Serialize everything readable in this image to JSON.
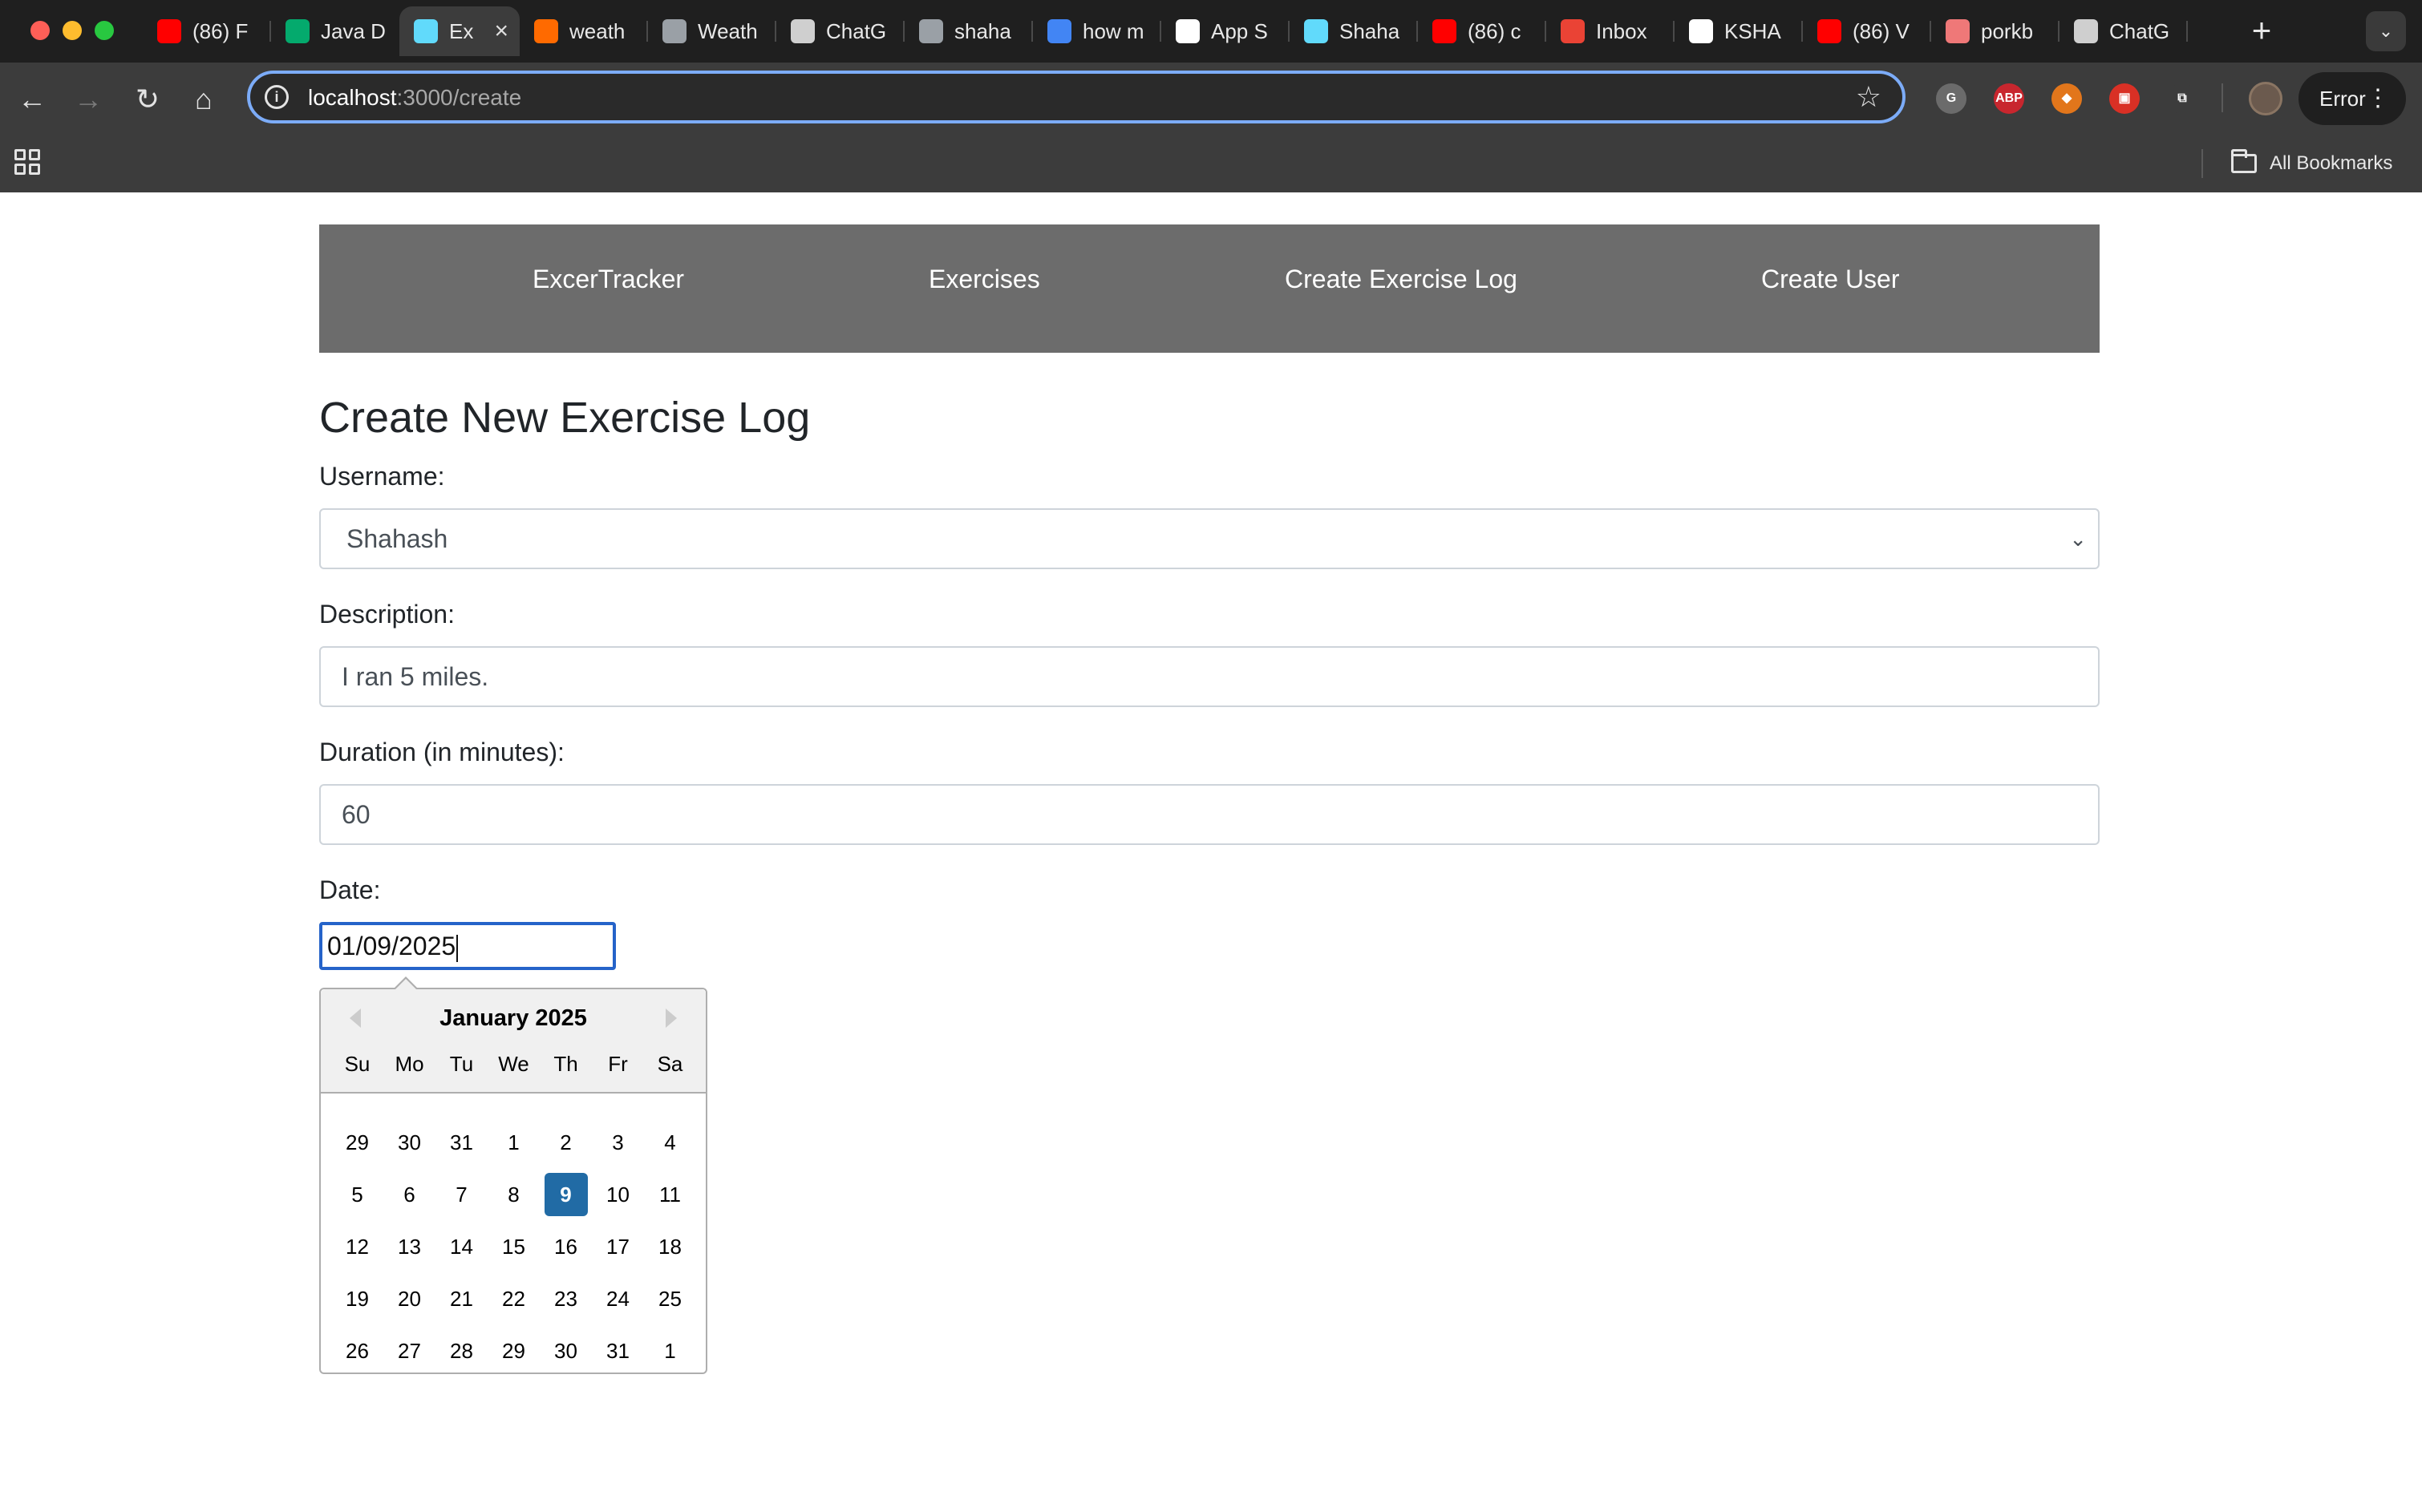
{
  "browser": {
    "tabs": [
      {
        "title": "(86) F",
        "icon": "youtube-icon",
        "color": "#ff0000"
      },
      {
        "title": "Java D",
        "icon": "w3schools-icon",
        "color": "#04aa6d"
      },
      {
        "title": "Ex",
        "icon": "react-icon",
        "color": "#61dafb",
        "active": true
      },
      {
        "title": "weath",
        "icon": "flame-icon",
        "color": "#ff6a00"
      },
      {
        "title": "Weath",
        "icon": "globe-icon",
        "color": "#9aa0a6"
      },
      {
        "title": "ChatG",
        "icon": "chatgpt-icon",
        "color": "#cfcfcf"
      },
      {
        "title": "shaha",
        "icon": "globe-icon",
        "color": "#9aa0a6"
      },
      {
        "title": "how m",
        "icon": "google-icon",
        "color": "#4285f4"
      },
      {
        "title": "App S",
        "icon": "github-icon",
        "color": "#ffffff"
      },
      {
        "title": "Shaha",
        "icon": "react-icon",
        "color": "#61dafb"
      },
      {
        "title": "(86) c",
        "icon": "youtube-icon",
        "color": "#ff0000"
      },
      {
        "title": "Inbox",
        "icon": "gmail-icon",
        "color": "#ea4335"
      },
      {
        "title": "KSHA",
        "icon": "github-icon",
        "color": "#ffffff"
      },
      {
        "title": "(86) V",
        "icon": "youtube-icon",
        "color": "#ff0000"
      },
      {
        "title": "porkb",
        "icon": "porkbun-icon",
        "color": "#ef7878"
      },
      {
        "title": "ChatG",
        "icon": "chatgpt-icon",
        "color": "#cfcfcf"
      }
    ],
    "url_host": "localhost",
    "url_path": ":3000/create",
    "error_label": "Error",
    "all_bookmarks_label": "All Bookmarks",
    "extensions": [
      {
        "name": "grammarly-icon",
        "label": "G",
        "color": "#6b6b6b"
      },
      {
        "name": "adblock-plus-icon",
        "label": "ABP",
        "color": "#c8262e"
      },
      {
        "name": "metamask-icon",
        "label": "◆",
        "color": "#e2761b"
      },
      {
        "name": "extension-red-icon",
        "label": "▣",
        "color": "#d93025"
      },
      {
        "name": "puzzle-icon",
        "label": "⧉",
        "color": "#3c3c3c"
      }
    ]
  },
  "nav": {
    "brand": "ExcerTracker",
    "links": [
      "Exercises",
      "Create Exercise Log",
      "Create User"
    ]
  },
  "form": {
    "title": "Create New Exercise Log",
    "username_label": "Username:",
    "username_value": "Shahash",
    "description_label": "Description:",
    "description_value": "I ran 5 miles.",
    "duration_label": "Duration (in minutes):",
    "duration_value": "60",
    "date_label": "Date:",
    "date_value": "01/09/2025"
  },
  "datepicker": {
    "month_label": "January 2025",
    "weekdays": [
      "Su",
      "Mo",
      "Tu",
      "We",
      "Th",
      "Fr",
      "Sa"
    ],
    "days": [
      "29",
      "30",
      "31",
      "1",
      "2",
      "3",
      "4",
      "5",
      "6",
      "7",
      "8",
      "9",
      "10",
      "11",
      "12",
      "13",
      "14",
      "15",
      "16",
      "17",
      "18",
      "19",
      "20",
      "21",
      "22",
      "23",
      "24",
      "25",
      "26",
      "27",
      "28",
      "29",
      "30",
      "31",
      "1"
    ],
    "selected_day": "9",
    "selected_color": "#216ba5"
  }
}
